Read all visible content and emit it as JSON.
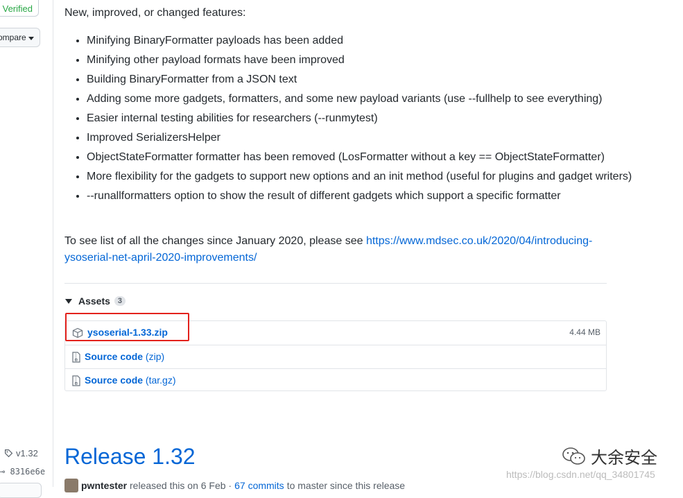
{
  "left": {
    "verified": "Verified",
    "compare": "ompare",
    "tag": "v1.32",
    "commit": "8316e6e"
  },
  "release": {
    "intro": "New, improved, or changed features:",
    "features": [
      "Minifying BinaryFormatter payloads has been added",
      "Minifying other payload formats have been improved",
      "Building BinaryFormatter from a JSON text",
      "Adding some more gadgets, formatters, and some new payload variants (use --fullhelp to see everything)",
      "Easier internal testing abilities for researchers (--runmytest)",
      "Improved SerializersHelper",
      "ObjectStateFormatter formatter has been removed (LosFormatter without a key == ObjectStateFormatter)",
      "More flexibility for the gadgets to support new options and an init method (useful for plugins and gadget writers)",
      "--runallformatters option to show the result of different gadgets which support a specific formatter"
    ],
    "changes_text": "To see list of all the changes since January 2020, please see ",
    "changes_link": "https://www.mdsec.co.uk/2020/04/introducing-ysoserial-net-april-2020-improvements/"
  },
  "assets": {
    "label": "Assets",
    "count": "3",
    "items": [
      {
        "name": "ysoserial-1.33.zip",
        "kind": "",
        "size": "4.44 MB",
        "icon": "package-icon"
      },
      {
        "name": "Source code",
        "kind": "(zip)",
        "size": "",
        "icon": "file-zip-icon"
      },
      {
        "name": "Source code",
        "kind": "(tar.gz)",
        "size": "",
        "icon": "file-zip-icon"
      }
    ]
  },
  "next_release": {
    "title": "Release 1.32",
    "author": "pwntester",
    "released_text": "released this on 6 Feb",
    "commits": "67 commits",
    "tail": "to master since this release"
  },
  "watermark": {
    "name": "大余安全",
    "url": "https://blog.csdn.net/qq_34801745"
  },
  "colors": {
    "link": "#0366d6",
    "highlight": "#e3211c",
    "verified": "#28a745"
  }
}
